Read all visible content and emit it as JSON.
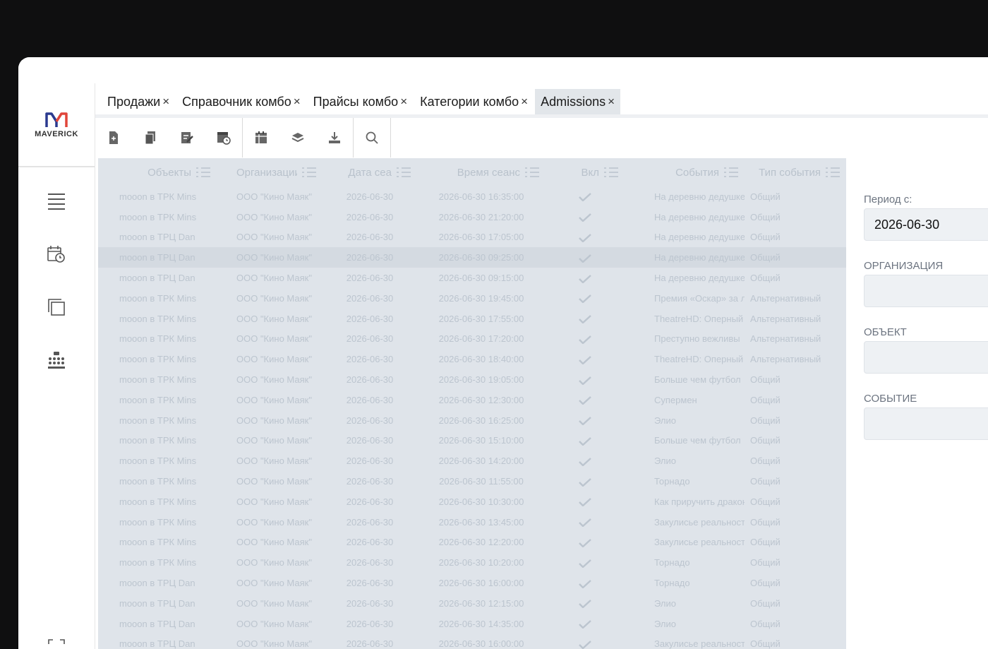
{
  "app": {
    "logo_letter": "M",
    "logo_text": "MAVERICK"
  },
  "tabs": [
    {
      "label": "Продажи",
      "active": false
    },
    {
      "label": "Справочник комбо",
      "active": false
    },
    {
      "label": "Прайсы комбо",
      "active": false
    },
    {
      "label": "Категории комбо",
      "active": false
    },
    {
      "label": "Admissions",
      "active": true
    }
  ],
  "tab_close_glyph": "×",
  "sidebar": {
    "icons": [
      "menu-icon",
      "calendar-clock-icon",
      "copy-icon",
      "seating-icon",
      "expand-icon"
    ]
  },
  "toolbar": {
    "buttons": [
      "new-doc-icon",
      "copy-doc-icon",
      "edit-doc-icon",
      "schedule-doc-icon",
      "report-icon",
      "layers-icon",
      "download-icon",
      "search-icon"
    ]
  },
  "grid": {
    "columns": [
      "Объекты",
      "Организации",
      "Дата сеа",
      "Время сеанс",
      "Вкл",
      "События",
      "Тип события"
    ],
    "rows": [
      [
        "mooon в ТРК Mins",
        "ООО \"Кино Маяк\"",
        "2026-06-30",
        "2026-06-30 16:35:00",
        true,
        "На деревню дедушке",
        "Общий"
      ],
      [
        "mooon в ТРК Mins",
        "ООО \"Кино Маяк\"",
        "2026-06-30",
        "2026-06-30 21:20:00",
        true,
        "На деревню дедушке",
        "Общий"
      ],
      [
        "mooon в ТРЦ Dan",
        "ООО \"Кино Маяк\"",
        "2026-06-30",
        "2026-06-30 17:05:00",
        true,
        "На деревню дедушке",
        "Общий"
      ],
      [
        "mooon в ТРЦ Dan",
        "ООО \"Кино Маяк\"",
        "2026-06-30",
        "2026-06-30 09:25:00",
        true,
        "На деревню дедушке",
        "Общий"
      ],
      [
        "mooon в ТРЦ Dan",
        "ООО \"Кино Маяк\"",
        "2026-06-30",
        "2026-06-30 09:15:00",
        true,
        "На деревню дедушке",
        "Общий"
      ],
      [
        "mooon в ТРК Mins",
        "ООО \"Кино Маяк\"",
        "2026-06-30",
        "2026-06-30 19:45:00",
        true,
        "Премия «Оскар» за л",
        "Альтернативный"
      ],
      [
        "mooon в ТРК Mins",
        "ООО \"Кино Маяк\"",
        "2026-06-30",
        "2026-06-30 17:55:00",
        true,
        "TheatreHD: Оперный",
        "Альтернативный"
      ],
      [
        "mooon в ТРК Mins",
        "ООО \"Кино Маяк\"",
        "2026-06-30",
        "2026-06-30 17:20:00",
        true,
        "Преступно вежливы",
        "Альтернативный"
      ],
      [
        "mooon в ТРК Mins",
        "ООО \"Кино Маяк\"",
        "2026-06-30",
        "2026-06-30 18:40:00",
        true,
        "TheatreHD: Оперный",
        "Альтернативный"
      ],
      [
        "mooon в ТРК Mins",
        "ООО \"Кино Маяк\"",
        "2026-06-30",
        "2026-06-30 19:05:00",
        true,
        "Больше чем футбол",
        "Общий"
      ],
      [
        "mooon в ТРК Mins",
        "ООО \"Кино Маяк\"",
        "2026-06-30",
        "2026-06-30 12:30:00",
        true,
        "Супермен",
        "Общий"
      ],
      [
        "mooon в ТРК Mins",
        "ООО \"Кино Маяк\"",
        "2026-06-30",
        "2026-06-30 16:25:00",
        true,
        "Элио",
        "Общий"
      ],
      [
        "mooon в ТРК Mins",
        "ООО \"Кино Маяк\"",
        "2026-06-30",
        "2026-06-30 15:10:00",
        true,
        "Больше чем футбол",
        "Общий"
      ],
      [
        "mooon в ТРК Mins",
        "ООО \"Кино Маяк\"",
        "2026-06-30",
        "2026-06-30 14:20:00",
        true,
        "Элио",
        "Общий"
      ],
      [
        "mooon в ТРК Mins",
        "ООО \"Кино Маяк\"",
        "2026-06-30",
        "2026-06-30 11:55:00",
        true,
        "Торнадо",
        "Общий"
      ],
      [
        "mooon в ТРК Mins",
        "ООО \"Кино Маяк\"",
        "2026-06-30",
        "2026-06-30 10:30:00",
        true,
        "Как приручить дракона",
        "Общий"
      ],
      [
        "mooon в ТРК Mins",
        "ООО \"Кино Маяк\"",
        "2026-06-30",
        "2026-06-30 13:45:00",
        true,
        "Закулисье реальности",
        "Общий"
      ],
      [
        "mooon в ТРК Mins",
        "ООО \"Кино Маяк\"",
        "2026-06-30",
        "2026-06-30 12:20:00",
        true,
        "Закулисье реальности",
        "Общий"
      ],
      [
        "mooon в ТРК Mins",
        "ООО \"Кино Маяк\"",
        "2026-06-30",
        "2026-06-30 10:20:00",
        true,
        "Торнадо",
        "Общий"
      ],
      [
        "mooon в ТРЦ Dan",
        "ООО \"Кино Маяк\"",
        "2026-06-30",
        "2026-06-30 16:00:00",
        true,
        "Торнадо",
        "Общий"
      ],
      [
        "mooon в ТРЦ Dan",
        "ООО \"Кино Маяк\"",
        "2026-06-30",
        "2026-06-30 12:15:00",
        true,
        "Элио",
        "Общий"
      ],
      [
        "mooon в ТРЦ Dan",
        "ООО \"Кино Маяк\"",
        "2026-06-30",
        "2026-06-30 14:35:00",
        true,
        "Элио",
        "Общий"
      ],
      [
        "mooon в ТРЦ Dan",
        "ООО \"Кино Маяк\"",
        "2026-06-30",
        "2026-06-30 16:00:00",
        true,
        "Закулисье реальности",
        "Общий"
      ]
    ],
    "selected_row": 3
  },
  "filters": {
    "period_label": "Период с:",
    "period_value": "2026-06-30",
    "org_label": "ОРГАНИЗАЦИЯ",
    "org_value": "",
    "object_label": "ОБЪЕКТ",
    "object_value": "",
    "event_label": "СОБЫТИЕ",
    "event_value": ""
  },
  "colors": {
    "accent_logo_left": "#2b3a8f",
    "accent_logo_right": "#e0453a",
    "grid_overlay": "#dfe4ea",
    "active_tab": "#e2e6ea"
  }
}
